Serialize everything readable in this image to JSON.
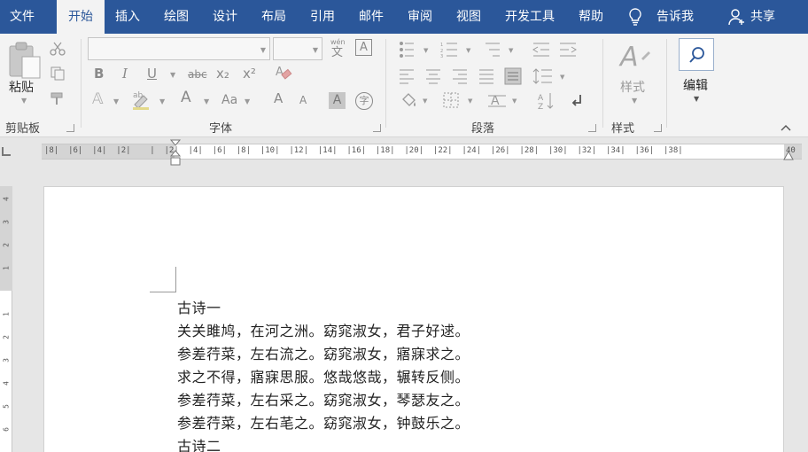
{
  "tabs": {
    "file": "文件",
    "home": "开始",
    "insert": "插入",
    "draw": "绘图",
    "design": "设计",
    "layout": "布局",
    "references": "引用",
    "mailings": "邮件",
    "review": "审阅",
    "view": "视图",
    "developer": "开发工具",
    "help": "帮助",
    "tell_me": "告诉我",
    "share": "共享"
  },
  "ribbon": {
    "clipboard": {
      "paste_label": "粘贴",
      "group_label": "剪贴板"
    },
    "font": {
      "group_label": "字体",
      "font_name": "",
      "font_size": "",
      "bold": "B",
      "italic": "I",
      "underline": "U",
      "strikethrough": "abc",
      "subscript": "x₂",
      "superscript": "x²",
      "font_color": "A",
      "grow_font": "A",
      "shrink_font": "A",
      "change_case": "Aa",
      "char_shading": "A",
      "enclose_char": "字",
      "phonetic_guide": "wén",
      "phonetic_char": "文",
      "char_border": "A"
    },
    "paragraph": {
      "group_label": "段落"
    },
    "styles": {
      "label": "样式",
      "group_label": "样式"
    },
    "editing": {
      "label": "编辑"
    }
  },
  "ruler": {
    "horizontal": "|8|  |6|  |4|  |2|    |  |2|  |4|  |6|  |8|  |10|  |12|  |14|  |16|  |18|  |20|  |22|  |24|  |26|  |28|  |30|  |32|  |34|  |36|  |38|",
    "right_end": "40",
    "vertical": [
      "4",
      "3",
      "2",
      "1",
      "",
      "1",
      "2",
      "3",
      "4",
      "5",
      "6"
    ]
  },
  "document": {
    "lines": [
      "古诗一",
      "关关雎鸠，在河之洲。窈窕淑女，君子好逑。",
      "参差荇菜，左右流之。窈窕淑女，寤寐求之。",
      "求之不得，寤寐思服。悠哉悠哉，辗转反侧。",
      "参差荇菜，左右采之。窈窕淑女，琴瑟友之。",
      "参差荇菜，左右芼之。窈窕淑女，钟鼓乐之。",
      "古诗二"
    ]
  },
  "colors": {
    "accent": "#2b579a",
    "ribbon_bg": "#f3f3f3",
    "workspace_bg": "#e6e6e6"
  }
}
